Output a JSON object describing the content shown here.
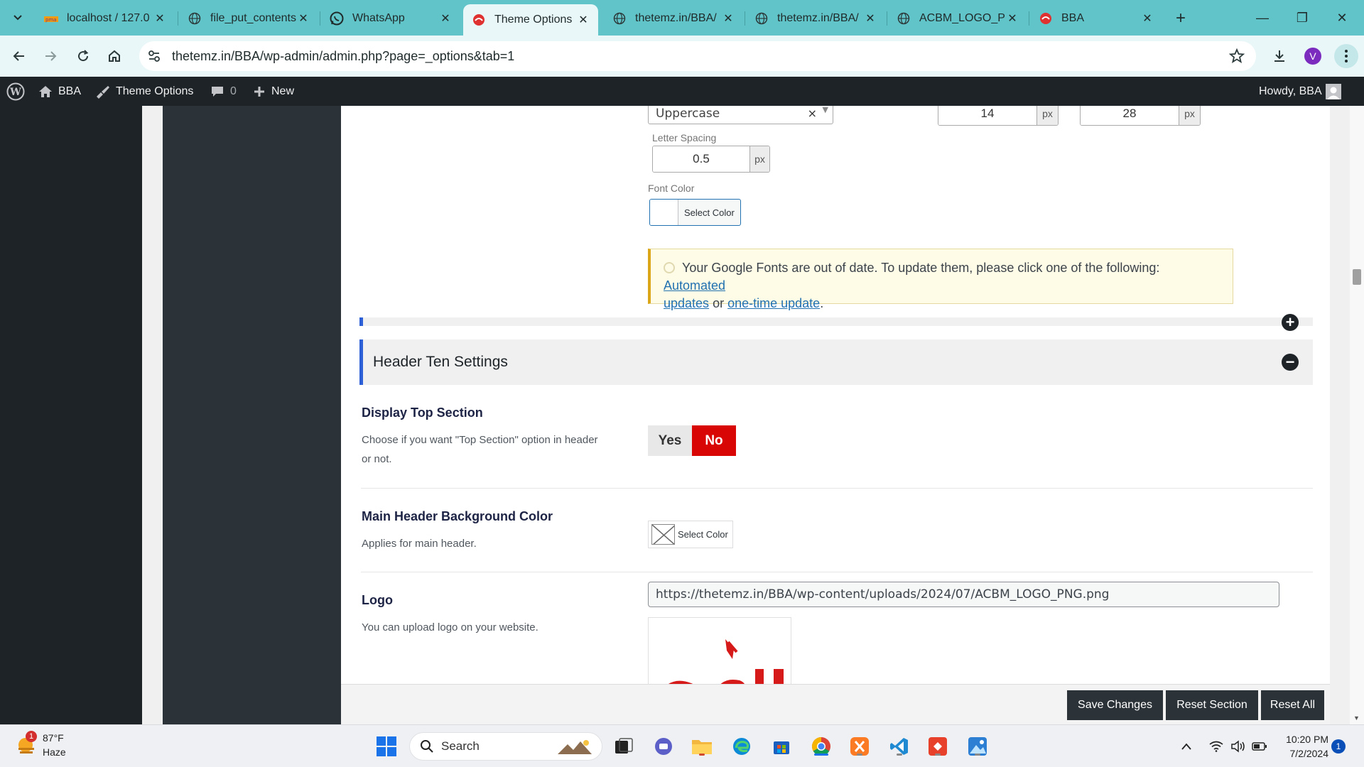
{
  "browser": {
    "tabs": [
      {
        "title": "localhost / 127.0",
        "icon": "phpmyadmin-icon"
      },
      {
        "title": "file_put_contents",
        "icon": "globe-icon"
      },
      {
        "title": "WhatsApp",
        "icon": "whatsapp-icon"
      },
      {
        "title": "Theme Options",
        "icon": "bba-logo-icon",
        "active": true
      },
      {
        "title": "thetemz.in/BBA/",
        "icon": "globe-icon"
      },
      {
        "title": "thetemz.in/BBA/",
        "icon": "globe-icon"
      },
      {
        "title": "ACBM_LOGO_PN",
        "icon": "globe-icon"
      },
      {
        "title": "BBA",
        "icon": "bba-logo-icon"
      }
    ],
    "url": "thetemz.in/BBA/wp-admin/admin.php?page=_options&tab=1",
    "profile_initial": "V",
    "accent": "#61c4c8"
  },
  "adminbar": {
    "site_name": "BBA",
    "theme_options": "Theme Options",
    "comments_count": "0",
    "new_label": "New",
    "howdy": "Howdy, BBA"
  },
  "typography": {
    "text_transform": "Uppercase",
    "font_size": "14",
    "line_height": "28",
    "unit": "px",
    "letter_spacing_label": "Letter Spacing",
    "letter_spacing": "0.5",
    "font_color_label": "Font Color",
    "select_color": "Select Color"
  },
  "notice": {
    "text": "Your Google Fonts are out of date. To update them, please click one of the following:",
    "link1_a": "Automated",
    "link1_b": "updates",
    "or": "or",
    "link2": "one-time update",
    "period": "."
  },
  "section": {
    "title": "Header Ten Settings",
    "accent": "#2d5fd6"
  },
  "options": {
    "top_section": {
      "title": "Display Top Section",
      "desc_line1": "Choose if you want \"Top Section\" option in header",
      "desc_line2": "or not.",
      "yes": "Yes",
      "no": "No",
      "selected": "No"
    },
    "bg_color": {
      "title": "Main Header Background Color",
      "desc": "Applies for main header.",
      "button": "Select Color"
    },
    "logo": {
      "title": "Logo",
      "desc": "You can upload logo on your website.",
      "url": "https://thetemz.in/BBA/wp-content/uploads/2024/07/ACBM_LOGO_PNG.png"
    }
  },
  "footer": {
    "save": "Save Changes",
    "reset_section": "Reset Section",
    "reset_all": "Reset All"
  },
  "taskbar": {
    "weather_temp": "87°F",
    "weather_desc": "Haze",
    "weather_badge": "1",
    "search": "Search",
    "time": "10:20 PM",
    "date": "7/2/2024",
    "notifications": "1"
  }
}
